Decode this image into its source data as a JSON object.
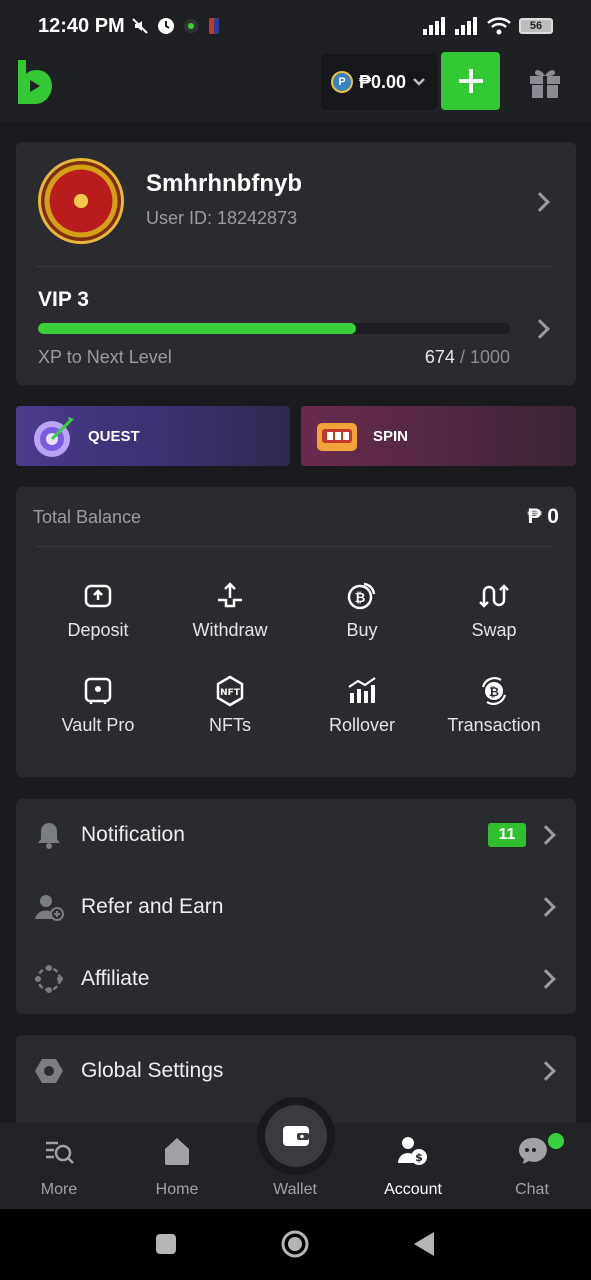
{
  "status_bar": {
    "time": "12:40 PM",
    "battery": "56"
  },
  "header": {
    "currency_symbol": "P",
    "balance": "₱0.00"
  },
  "profile": {
    "username": "Smhrhnbfnyb",
    "user_id": "User ID: 18242873",
    "vip_level": "VIP 3",
    "xp_label": "XP to Next Level",
    "xp_current": "674",
    "xp_max": " / 1000",
    "xp_progress": 0.674
  },
  "promos": [
    {
      "label": "QUEST"
    },
    {
      "label": "SPIN"
    }
  ],
  "balance": {
    "label": "Total Balance",
    "value": "₱ 0",
    "actions": [
      {
        "label": "Deposit",
        "icon": "deposit-icon"
      },
      {
        "label": "Withdraw",
        "icon": "withdraw-icon"
      },
      {
        "label": "Buy",
        "icon": "buy-crypto-icon"
      },
      {
        "label": "Swap",
        "icon": "swap-icon"
      },
      {
        "label": "Vault Pro",
        "icon": "vault-icon"
      },
      {
        "label": "NFTs",
        "icon": "nft-icon"
      },
      {
        "label": "Rollover",
        "icon": "rollover-chart-icon"
      },
      {
        "label": "Transaction",
        "icon": "transaction-icon"
      }
    ]
  },
  "menu": [
    {
      "label": "Notification",
      "icon": "bell-icon",
      "badge": "11"
    },
    {
      "label": "Refer and Earn",
      "icon": "refer-user-icon"
    },
    {
      "label": "Affiliate",
      "icon": "affiliate-icon"
    }
  ],
  "settings": {
    "label": "Global Settings",
    "icon": "settings-hex-icon"
  },
  "tabs": [
    {
      "label": "More",
      "icon": "more-search-icon"
    },
    {
      "label": "Home",
      "icon": "home-icon"
    },
    {
      "label": "Wallet",
      "icon": "wallet-icon"
    },
    {
      "label": "Account",
      "icon": "account-icon"
    },
    {
      "label": "Chat",
      "icon": "chat-icon"
    }
  ],
  "colors": {
    "accent": "#34c934",
    "background": "#1a1b1e",
    "card": "#2a2b2f"
  }
}
